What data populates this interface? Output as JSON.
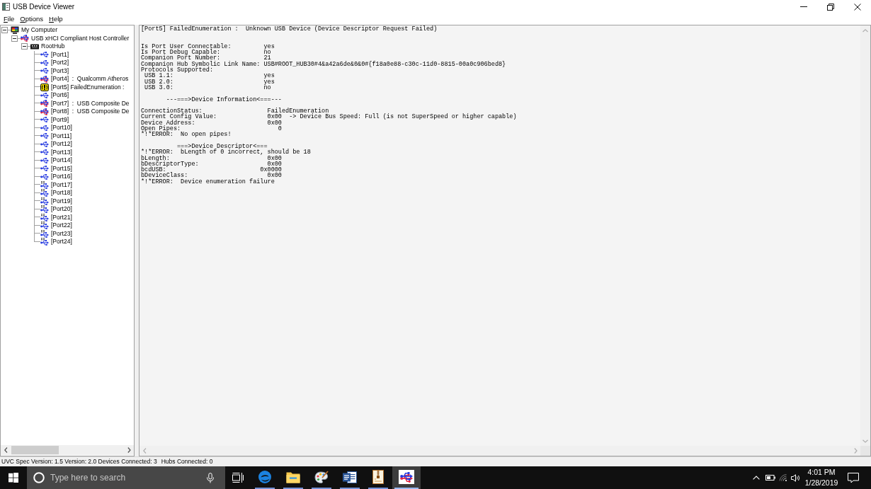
{
  "window": {
    "title": "USB Device Viewer"
  },
  "menu": [
    "File",
    "Options",
    "Help"
  ],
  "tree": [
    {
      "label": "My Computer",
      "kind": "computer",
      "expanded": true,
      "children": [
        {
          "label": "USB xHCI Compliant Host Controller",
          "kind": "controller",
          "expanded": true,
          "children": [
            {
              "label": "RootHub",
              "kind": "hub",
              "expanded": true,
              "children": [
                {
                  "label": "[Port1]",
                  "kind": "port"
                },
                {
                  "label": "[Port2]",
                  "kind": "port"
                },
                {
                  "label": "[Port3]",
                  "kind": "port"
                },
                {
                  "label": "[Port4]  :  Qualcomm Atheros",
                  "kind": "device"
                },
                {
                  "label": "[Port5] FailedEnumeration :",
                  "kind": "error"
                },
                {
                  "label": "[Port6]",
                  "kind": "port"
                },
                {
                  "label": "[Port7]  :  USB Composite De",
                  "kind": "device"
                },
                {
                  "label": "[Port8]  :  USB Composite De",
                  "kind": "device"
                },
                {
                  "label": "[Port9]",
                  "kind": "port"
                },
                {
                  "label": "[Port10]",
                  "kind": "port"
                },
                {
                  "label": "[Port11]",
                  "kind": "port"
                },
                {
                  "label": "[Port12]",
                  "kind": "port"
                },
                {
                  "label": "[Port13]",
                  "kind": "port"
                },
                {
                  "label": "[Port14]",
                  "kind": "port"
                },
                {
                  "label": "[Port15]",
                  "kind": "port"
                },
                {
                  "label": "[Port16]",
                  "kind": "port"
                },
                {
                  "label": "[Port17]",
                  "kind": "ss_port"
                },
                {
                  "label": "[Port18]",
                  "kind": "ss_port"
                },
                {
                  "label": "[Port19]",
                  "kind": "ss_port"
                },
                {
                  "label": "[Port20]",
                  "kind": "ss_port"
                },
                {
                  "label": "[Port21]",
                  "kind": "ss_port"
                },
                {
                  "label": "[Port22]",
                  "kind": "ss_port"
                },
                {
                  "label": "[Port23]",
                  "kind": "ss_port"
                },
                {
                  "label": "[Port24]",
                  "kind": "ss_port"
                }
              ]
            }
          ]
        }
      ]
    }
  ],
  "details": {
    "title": "[Port5] FailedEnumeration :  Unknown USB Device (Device Descriptor Request Failed)",
    "sections": [
      [
        "Is Port User Connectable:         yes",
        "Is Port Debug Capable:            no",
        "Companion Port Number:            21",
        "Companion Hub Symbolic Link Name: USB#ROOT_HUB30#4&a42a6de&0&0#{f18a0e88-c30c-11d0-8815-00a0c906bed8}",
        "Protocols Supported:",
        " USB 1.1:                         yes",
        " USB 2.0:                         yes",
        " USB 3.0:                         no"
      ],
      [
        "       ---===>Device Information<===---"
      ],
      [
        "ConnectionStatus:                  FailedEnumeration",
        "Current Config Value:              0x00  -> Device Bus Speed: Full (is not SuperSpeed or higher capable)",
        "Device Address:                    0x00",
        "Open Pipes:                           0",
        "*!*ERROR:  No open pipes!"
      ],
      [
        "          ===>Device Descriptor<===",
        "*!*ERROR:  bLength of 0 incorrect, should be 18",
        "bLength:                           0x00",
        "bDescriptorType:                   0x00",
        "bcdUSB:                          0x0000",
        "bDeviceClass:                      0x00",
        "*!*ERROR:  Device enumeration failure"
      ]
    ]
  },
  "status_bar": {
    "fields": [
      "UVC Spec Version: 1.5 Version: 2.0 Devices Connected: 3",
      "Hubs Connected: 0"
    ]
  },
  "taskbar": {
    "search": {
      "placeholder": "Type here to search"
    },
    "apps": [
      {
        "kind": "browser",
        "running": true,
        "selected": false
      },
      {
        "kind": "folder",
        "running": true,
        "selected": false
      },
      {
        "kind": "paint",
        "running": true,
        "selected": false
      },
      {
        "kind": "word",
        "running": true,
        "selected": false
      },
      {
        "kind": "archive",
        "running": true,
        "selected": false
      },
      {
        "kind": "usb_viewer",
        "running": true,
        "selected": true
      }
    ],
    "clock": {
      "time": "4:01 PM",
      "date": "1/28/2019"
    }
  }
}
